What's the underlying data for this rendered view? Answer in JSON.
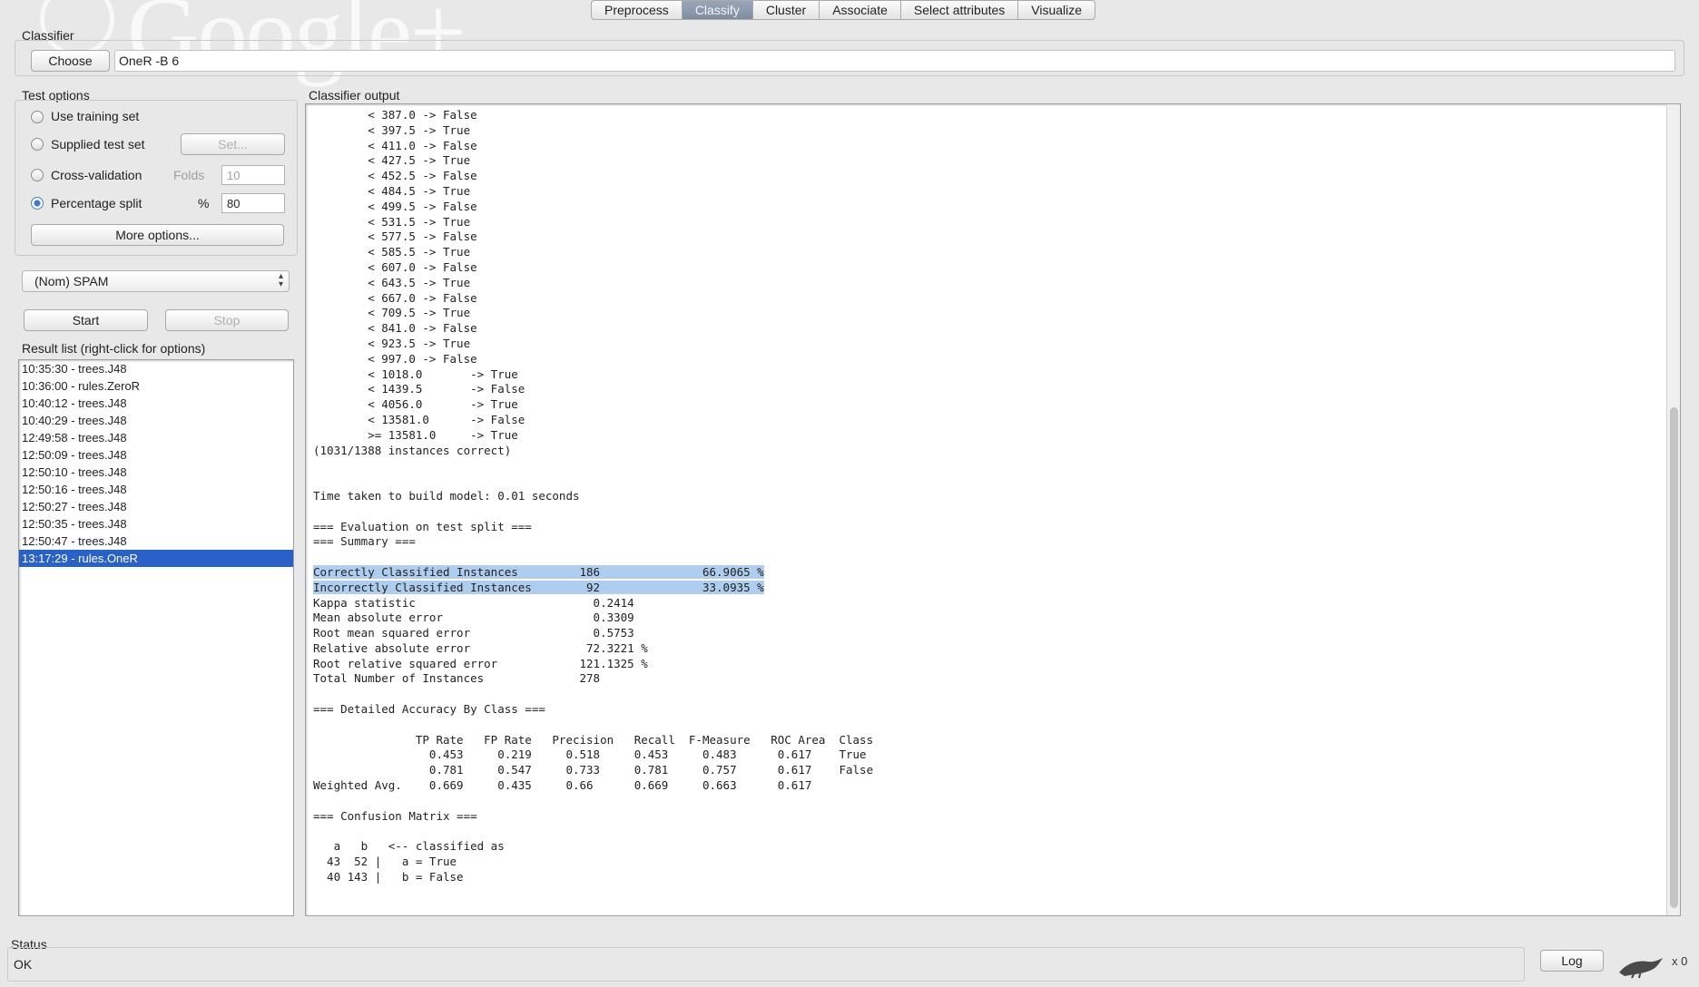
{
  "tabs": [
    "Preprocess",
    "Classify",
    "Cluster",
    "Associate",
    "Select attributes",
    "Visualize"
  ],
  "active_tab": "Classify",
  "watermark": "Google+",
  "classifier": {
    "group_label": "Classifier",
    "choose_label": "Choose",
    "config": "OneR -B 6"
  },
  "test_options": {
    "group_label": "Test options",
    "use_training_set": "Use training set",
    "supplied_test_set": "Supplied test set",
    "set_button": "Set...",
    "cross_validation": "Cross-validation",
    "folds_label": "Folds",
    "folds_value": "10",
    "percentage_split": "Percentage split",
    "percent_symbol": "%",
    "percent_value": "80",
    "selected": "percentage_split",
    "more_options": "More options..."
  },
  "class_attribute": "(Nom) SPAM",
  "start_label": "Start",
  "stop_label": "Stop",
  "result_list": {
    "label": "Result list (right-click for options)",
    "items": [
      "10:35:30 - trees.J48",
      "10:36:00 - rules.ZeroR",
      "10:40:12 - trees.J48",
      "10:40:29 - trees.J48",
      "12:49:58 - trees.J48",
      "12:50:09 - trees.J48",
      "12:50:10 - trees.J48",
      "12:50:16 - trees.J48",
      "12:50:27 - trees.J48",
      "12:50:35 - trees.J48",
      "12:50:47 - trees.J48",
      "13:17:29 - rules.OneR"
    ],
    "selected_index": 11
  },
  "output": {
    "label": "Classifier output",
    "lines": [
      "        < 387.0 -> False",
      "        < 397.5 -> True",
      "        < 411.0 -> False",
      "        < 427.5 -> True",
      "        < 452.5 -> False",
      "        < 484.5 -> True",
      "        < 499.5 -> False",
      "        < 531.5 -> True",
      "        < 577.5 -> False",
      "        < 585.5 -> True",
      "        < 607.0 -> False",
      "        < 643.5 -> True",
      "        < 667.0 -> False",
      "        < 709.5 -> True",
      "        < 841.0 -> False",
      "        < 923.5 -> True",
      "        < 997.0 -> False",
      "        < 1018.0       -> True",
      "        < 1439.5       -> False",
      "        < 4056.0       -> True",
      "        < 13581.0      -> False",
      "        >= 13581.0     -> True",
      "(1031/1388 instances correct)",
      "",
      "",
      "Time taken to build model: 0.01 seconds",
      "",
      "=== Evaluation on test split ===",
      "=== Summary ===",
      "",
      "Correctly Classified Instances         186               66.9065 %",
      "Incorrectly Classified Instances        92               33.0935 %",
      "Kappa statistic                          0.2414",
      "Mean absolute error                      0.3309",
      "Root mean squared error                  0.5753",
      "Relative absolute error                 72.3221 %",
      "Root relative squared error            121.1325 %",
      "Total Number of Instances              278",
      "",
      "=== Detailed Accuracy By Class ===",
      "",
      "               TP Rate   FP Rate   Precision   Recall  F-Measure   ROC Area  Class",
      "                 0.453     0.219     0.518     0.453     0.483      0.617    True",
      "                 0.781     0.547     0.733     0.781     0.757      0.617    False",
      "Weighted Avg.    0.669     0.435     0.66      0.669     0.663      0.617",
      "",
      "=== Confusion Matrix ===",
      "",
      "   a   b   <-- classified as",
      "  43  52 |   a = True",
      "  40 143 |   b = False"
    ],
    "highlighted_line_indices": [
      30,
      31
    ]
  },
  "status": {
    "label": "Status",
    "text": "OK",
    "log_button": "Log",
    "x_count": "x 0"
  }
}
